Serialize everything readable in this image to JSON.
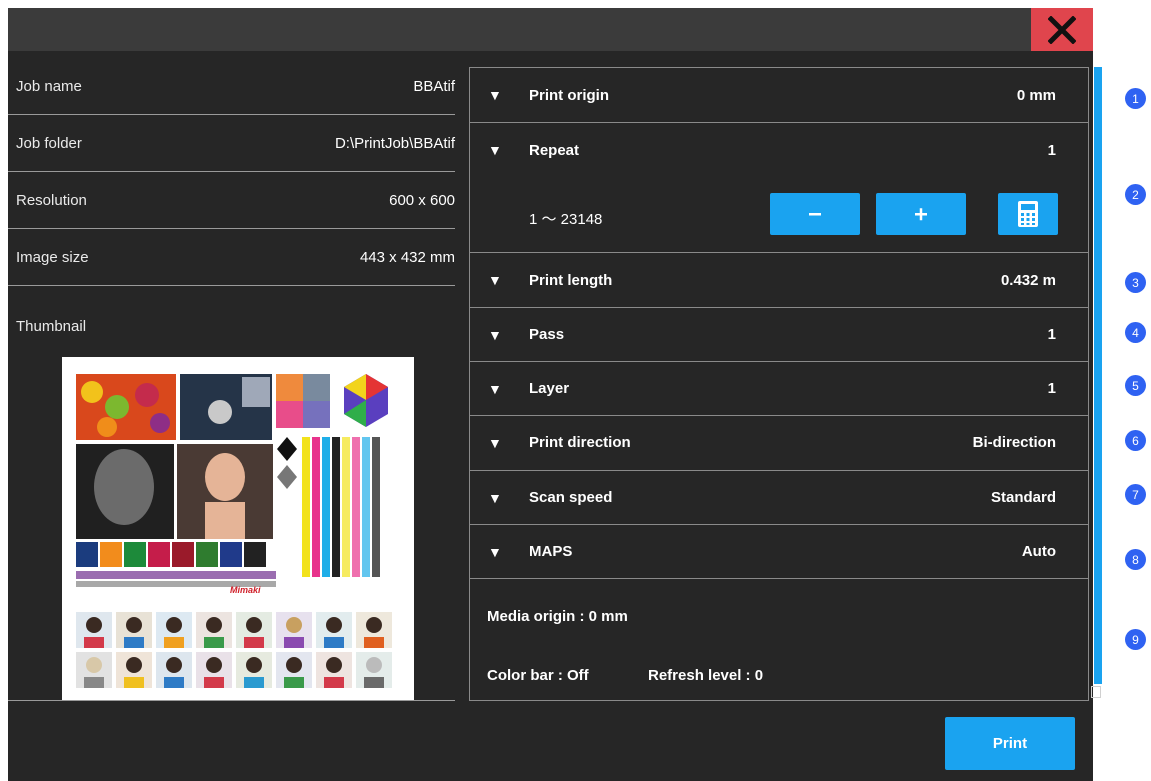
{
  "job_info": {
    "rows": [
      {
        "label": "Job name",
        "value": "BBAtif"
      },
      {
        "label": "Job folder",
        "value": "D:\\PrintJob\\BBAtif"
      },
      {
        "label": "Resolution",
        "value": "600 x 600"
      },
      {
        "label": "Image size",
        "value": "443 x 432 mm"
      }
    ],
    "thumbnail_label": "Thumbnail",
    "thumbnail_logo": "Mimaki"
  },
  "settings": {
    "rows": [
      {
        "label": "Print origin",
        "value": "0 mm"
      },
      {
        "label": "Repeat",
        "value": "1"
      },
      {
        "label": "Print length",
        "value": "0.432 m"
      },
      {
        "label": "Pass",
        "value": "1"
      },
      {
        "label": "Layer",
        "value": "1"
      },
      {
        "label": "Print direction",
        "value": "Bi-direction"
      },
      {
        "label": "Scan speed",
        "value": "Standard"
      },
      {
        "label": "MAPS",
        "value": "Auto"
      }
    ],
    "repeat_range": "1 ～ 23148",
    "summary": {
      "media_origin": "Media origin : 0 mm",
      "color_bar": "Color bar : Off",
      "refresh_level": "Refresh level : 0"
    }
  },
  "actions": {
    "print_label": "Print"
  },
  "markers": [
    "1",
    "2",
    "3",
    "4",
    "5",
    "6",
    "7",
    "8",
    "9"
  ],
  "icons": {
    "close": "close-icon",
    "minus": "minus-icon",
    "plus": "plus-icon",
    "calculator": "calculator-icon",
    "expand": "triangle-down-icon"
  },
  "colors": {
    "accent": "#1aa3f0",
    "close": "#e0454d",
    "background": "#262626",
    "marker": "#2f62f2"
  }
}
